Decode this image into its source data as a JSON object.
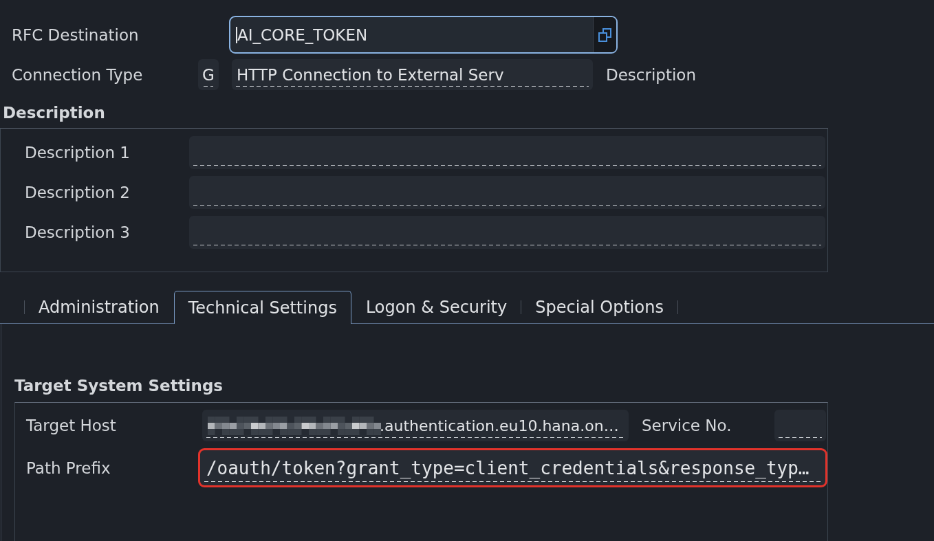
{
  "header": {
    "rfc_destination": {
      "label": "RFC Destination",
      "value": "AI_CORE_TOKEN",
      "focused": true
    },
    "connection_type": {
      "label": "Connection Type",
      "code": "G",
      "text": "HTTP Connection to External Serv",
      "description_label": "Description"
    }
  },
  "description_section": {
    "title": "Description",
    "fields": [
      {
        "label": "Description 1"
      },
      {
        "label": "Description 2"
      },
      {
        "label": "Description 3"
      }
    ]
  },
  "tabs": [
    {
      "label": "Administration",
      "selected": false
    },
    {
      "label": "Technical Settings",
      "selected": true
    },
    {
      "label": "Logon & Security",
      "selected": false
    },
    {
      "label": "Special Options",
      "selected": false
    }
  ],
  "target_system_settings": {
    "title": "Target System Settings",
    "target_host": {
      "label": "Target Host",
      "value": ".authentication.eu10.hana.on…",
      "redacted": true
    },
    "service_no": {
      "label": "Service No."
    },
    "path_prefix": {
      "label": "Path Prefix",
      "value": "/oauth/token?grant_type=client_credentials&response_typ…",
      "highlighted": true
    }
  }
}
